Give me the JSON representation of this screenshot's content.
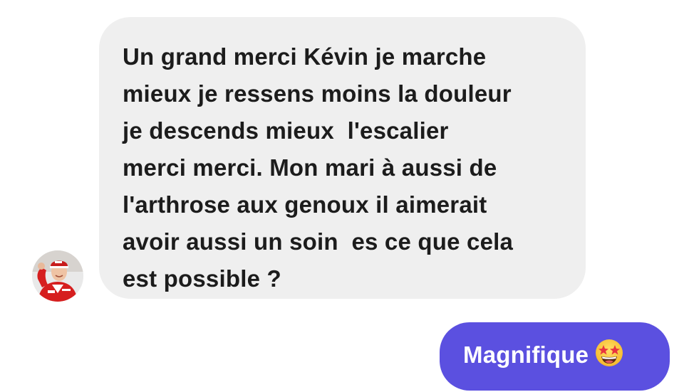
{
  "conversation": {
    "incoming_message": {
      "lines": [
        "Un grand merci Kévin je marche",
        "mieux je ressens moins la douleur",
        "je descends mieux  l'escalier",
        "merci merci. Mon mari à aussi de",
        "l'arthrose aux genoux il aimerait",
        "avoir aussi un soin  es ce que cela",
        "est possible ?"
      ]
    },
    "outgoing_message": {
      "text": "Magnifique",
      "emoji": "star-struck-emoji"
    }
  },
  "colors": {
    "incoming_bubble": "#efefef",
    "incoming_text": "#1c1c1c",
    "outgoing_bubble": "#5b50e0",
    "outgoing_text": "#ffffff"
  }
}
